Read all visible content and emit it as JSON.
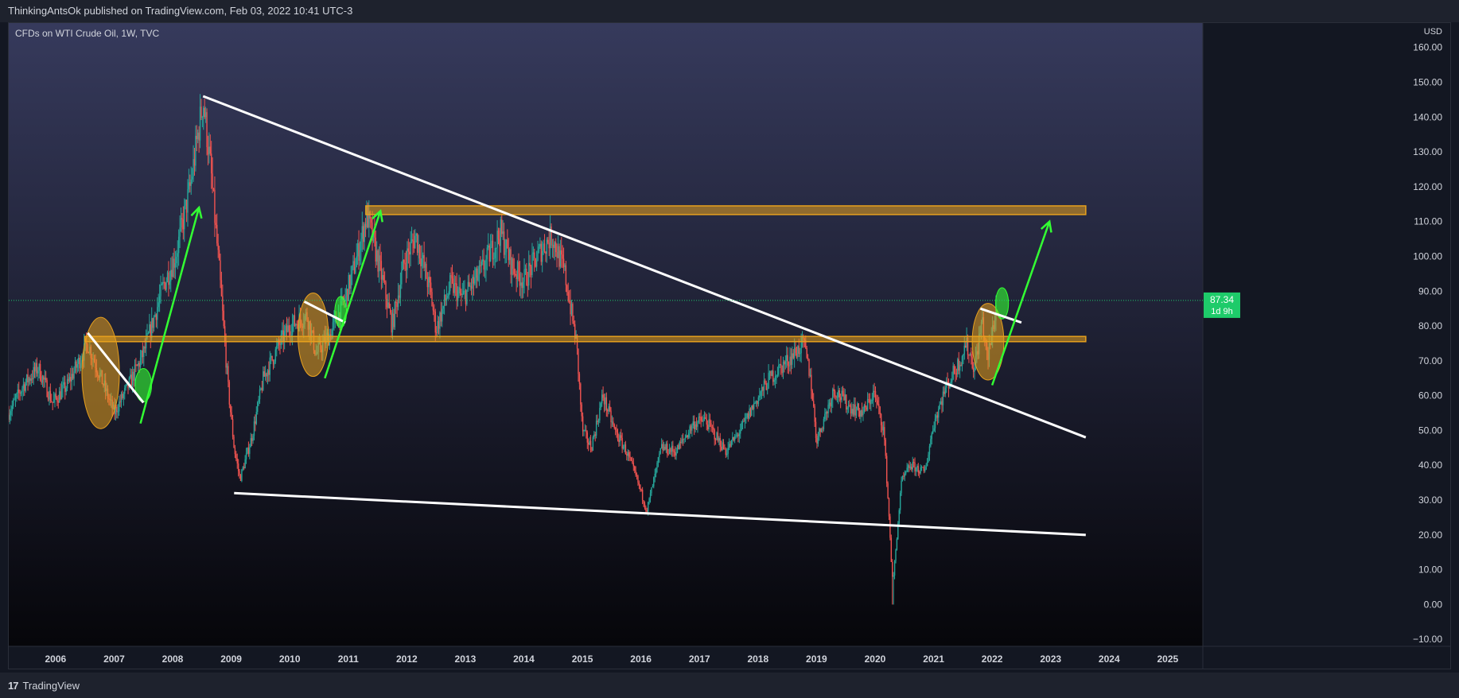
{
  "header": {
    "published": "ThinkingAntsOk published on TradingView.com, Feb 03, 2022 10:41 UTC-3"
  },
  "symbol": {
    "label": "CFDs on WTI Crude Oil, 1W, TVC"
  },
  "footer": {
    "brand": "TradingView",
    "logo_icon": "tv-logo-icon"
  },
  "colors": {
    "background_top": "#363a5c",
    "background_bottom": "#06060a",
    "candle_up": "#26a69a",
    "candle_down": "#ef5350",
    "trendline": "#ffffff",
    "arrow": "#33ff33",
    "zone": "#e6a01e",
    "price_tag": "#1ecb6a",
    "axis_text": "#d1d4dc"
  },
  "price_tag": {
    "value": "87.34",
    "countdown": "1d 9h"
  },
  "chart_data": {
    "type": "candlestick",
    "title": "CFDs on WTI Crude Oil, 1W, TVC",
    "currency": "USD",
    "timeframe": "1W",
    "xlim": [
      2005.2,
      2025.6
    ],
    "ylim": [
      -12,
      167
    ],
    "y_ticks": [
      -10,
      0,
      10,
      20,
      30,
      40,
      50,
      60,
      70,
      80,
      90,
      100,
      110,
      120,
      130,
      140,
      150,
      160
    ],
    "y_tick_labels": [
      "−10.00",
      "0.00",
      "10.00",
      "20.00",
      "30.00",
      "40.00",
      "50.00",
      "60.00",
      "70.00",
      "80.00",
      "90.00",
      "100.00",
      "110.00",
      "120.00",
      "130.00",
      "140.00",
      "150.00",
      "160.00"
    ],
    "x_ticks": [
      "2006",
      "2007",
      "2008",
      "2009",
      "2010",
      "2011",
      "2012",
      "2013",
      "2014",
      "2015",
      "2016",
      "2017",
      "2018",
      "2019",
      "2020",
      "2021",
      "2022",
      "2023",
      "2024",
      "2025"
    ],
    "last_price": 87.34,
    "price_path": [
      [
        2005.2,
        55
      ],
      [
        2005.45,
        63
      ],
      [
        2005.7,
        68
      ],
      [
        2005.95,
        58
      ],
      [
        2006.2,
        63
      ],
      [
        2006.55,
        75
      ],
      [
        2006.8,
        64
      ],
      [
        2007.0,
        55
      ],
      [
        2007.25,
        63
      ],
      [
        2007.5,
        72
      ],
      [
        2007.85,
        92
      ],
      [
        2008.05,
        100
      ],
      [
        2008.3,
        120
      ],
      [
        2008.52,
        145
      ],
      [
        2008.65,
        125
      ],
      [
        2008.8,
        95
      ],
      [
        2008.95,
        62
      ],
      [
        2009.05,
        45
      ],
      [
        2009.15,
        36
      ],
      [
        2009.35,
        48
      ],
      [
        2009.55,
        65
      ],
      [
        2009.8,
        74
      ],
      [
        2010.0,
        80
      ],
      [
        2010.3,
        83
      ],
      [
        2010.45,
        72
      ],
      [
        2010.7,
        78
      ],
      [
        2010.95,
        88
      ],
      [
        2011.15,
        100
      ],
      [
        2011.32,
        112
      ],
      [
        2011.6,
        92
      ],
      [
        2011.75,
        80
      ],
      [
        2011.95,
        98
      ],
      [
        2012.15,
        106
      ],
      [
        2012.4,
        90
      ],
      [
        2012.5,
        79
      ],
      [
        2012.75,
        92
      ],
      [
        2012.95,
        88
      ],
      [
        2013.25,
        95
      ],
      [
        2013.6,
        107
      ],
      [
        2013.8,
        97
      ],
      [
        2014.0,
        93
      ],
      [
        2014.3,
        102
      ],
      [
        2014.48,
        106
      ],
      [
        2014.7,
        95
      ],
      [
        2014.9,
        75
      ],
      [
        2015.0,
        50
      ],
      [
        2015.15,
        45
      ],
      [
        2015.35,
        60
      ],
      [
        2015.55,
        50
      ],
      [
        2015.75,
        44
      ],
      [
        2015.95,
        35
      ],
      [
        2016.1,
        27
      ],
      [
        2016.35,
        45
      ],
      [
        2016.6,
        44
      ],
      [
        2016.9,
        52
      ],
      [
        2017.1,
        53
      ],
      [
        2017.45,
        44
      ],
      [
        2017.7,
        50
      ],
      [
        2017.95,
        58
      ],
      [
        2018.2,
        65
      ],
      [
        2018.5,
        70
      ],
      [
        2018.78,
        75
      ],
      [
        2018.9,
        65
      ],
      [
        2019.0,
        47
      ],
      [
        2019.3,
        62
      ],
      [
        2019.55,
        57
      ],
      [
        2019.8,
        55
      ],
      [
        2019.98,
        61
      ],
      [
        2020.15,
        50
      ],
      [
        2020.25,
        22
      ],
      [
        2020.3,
        5
      ],
      [
        2020.45,
        35
      ],
      [
        2020.6,
        40
      ],
      [
        2020.85,
        38
      ],
      [
        2021.0,
        52
      ],
      [
        2021.2,
        62
      ],
      [
        2021.45,
        70
      ],
      [
        2021.55,
        75
      ],
      [
        2021.7,
        68
      ],
      [
        2021.83,
        82
      ],
      [
        2021.92,
        70
      ],
      [
        2022.0,
        78
      ],
      [
        2022.08,
        87
      ]
    ],
    "annotations": {
      "trendlines": [
        {
          "from": [
            2008.52,
            146
          ],
          "to": [
            2023.6,
            48
          ]
        },
        {
          "from": [
            2009.05,
            32
          ],
          "to": [
            2023.6,
            20
          ]
        },
        {
          "from": [
            2006.55,
            78
          ],
          "to": [
            2007.5,
            58
          ]
        },
        {
          "from": [
            2010.25,
            87
          ],
          "to": [
            2010.95,
            81
          ]
        },
        {
          "from": [
            2021.8,
            85
          ],
          "to": [
            2022.5,
            81
          ]
        }
      ],
      "zones": [
        {
          "y0": 112,
          "y1": 114.5,
          "x0": 2011.3,
          "x1": 2023.6
        },
        {
          "y0": 75.5,
          "y1": 77,
          "x0": 2006.5,
          "x1": 2023.6
        }
      ],
      "arrows": [
        {
          "from": [
            2007.45,
            52
          ],
          "to": [
            2008.45,
            114
          ]
        },
        {
          "from": [
            2010.6,
            65
          ],
          "to": [
            2011.55,
            113
          ]
        },
        {
          "from": [
            2022.0,
            63
          ],
          "to": [
            2022.98,
            110
          ]
        }
      ],
      "ellipses": [
        {
          "cx": 2006.77,
          "cy": 66.5,
          "rx": 0.32,
          "ry": 16,
          "color": "zone"
        },
        {
          "cx": 2007.5,
          "cy": 63,
          "rx": 0.14,
          "ry": 4.8,
          "color": "arrow"
        },
        {
          "cx": 2010.4,
          "cy": 77.5,
          "rx": 0.26,
          "ry": 12,
          "color": "zone"
        },
        {
          "cx": 2010.87,
          "cy": 84,
          "rx": 0.1,
          "ry": 4.5,
          "color": "arrow"
        },
        {
          "cx": 2021.93,
          "cy": 75.5,
          "rx": 0.27,
          "ry": 11,
          "color": "zone"
        },
        {
          "cx": 2022.17,
          "cy": 86.5,
          "rx": 0.11,
          "ry": 4.5,
          "color": "arrow"
        }
      ]
    }
  }
}
